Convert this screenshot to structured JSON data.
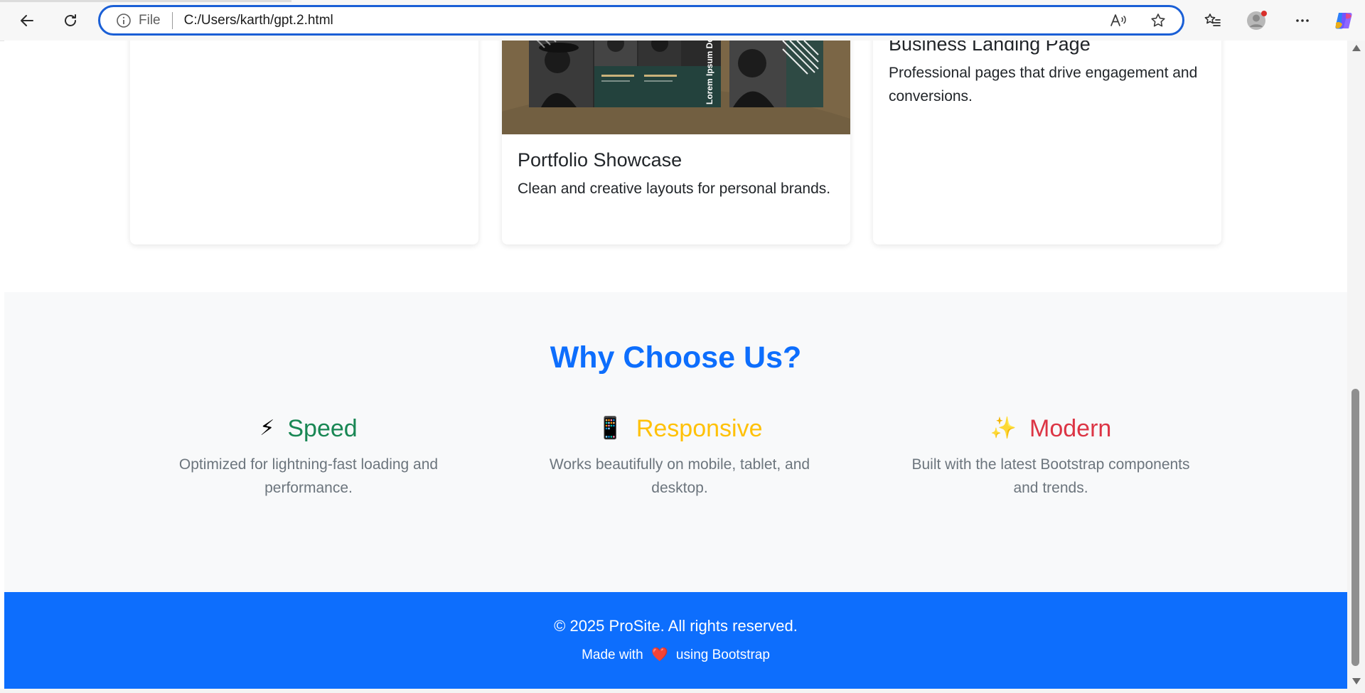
{
  "browser": {
    "file_label": "File",
    "url": "C:/Users/karth/gpt.2.html"
  },
  "cards": [
    {
      "title": "",
      "text": ""
    },
    {
      "title": "Portfolio Showcase",
      "text": "Clean and creative layouts for personal brands.",
      "image_text": "Lorem Ipsum Dolor"
    },
    {
      "title": "Business Landing Page",
      "text": "Professional pages that drive engagement and conversions."
    }
  ],
  "why": {
    "title": "Why Choose Us?",
    "features": [
      {
        "icon": "⚡",
        "icon_name": "lightning-icon",
        "title": "Speed",
        "color": "#198754",
        "text": "Optimized for lightning-fast loading and performance."
      },
      {
        "icon": "📱",
        "icon_name": "tablet-icon",
        "title": "Responsive",
        "color": "#ffc107",
        "text": "Works beautifully on mobile, tablet, and desktop."
      },
      {
        "icon": "✨",
        "icon_name": "sparkles-icon",
        "title": "Modern",
        "color": "#dc3545",
        "text": "Built with the latest Bootstrap components and trends."
      }
    ]
  },
  "footer": {
    "copyright": "© 2025 ProSite. All rights reserved.",
    "made_with_prefix": "Made with",
    "heart": "❤️",
    "made_with_suffix": "using Bootstrap"
  },
  "colors": {
    "primary": "#0d6efd",
    "light_bg": "#f8f9fa",
    "address_border": "#1a5fd6"
  }
}
